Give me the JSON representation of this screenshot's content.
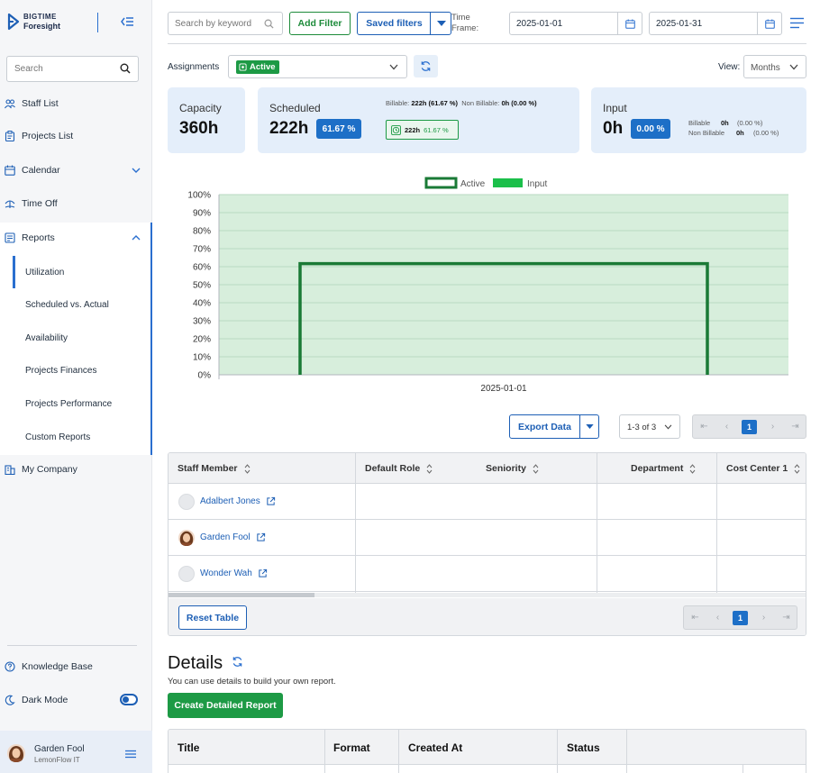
{
  "brand": {
    "line1": "BIGTIME",
    "line2": "Foresight"
  },
  "sidebar": {
    "search_placeholder": "Search",
    "items": [
      {
        "label": "Staff List",
        "icon": "users-icon"
      },
      {
        "label": "Projects List",
        "icon": "clipboard-icon"
      },
      {
        "label": "Calendar",
        "icon": "calendar-icon"
      },
      {
        "label": "Time Off",
        "icon": "time-off-icon"
      },
      {
        "label": "Reports",
        "icon": "report-icon"
      },
      {
        "label": "My Company",
        "icon": "building-icon"
      }
    ],
    "report_sub": [
      "Utilization",
      "Scheduled vs. Actual",
      "Availability",
      "Projects Finances",
      "Projects Performance",
      "Custom Reports"
    ],
    "active_sub": "Utilization",
    "knowledge_base": "Knowledge Base",
    "dark_mode": "Dark Mode",
    "dark_mode_on": true,
    "user": {
      "name": "Garden Fool",
      "org": "LemonFlow IT"
    }
  },
  "toolbar": {
    "keyword_placeholder": "Search by keyword",
    "add_filter": "Add Filter",
    "saved_filters": "Saved filters",
    "time_frame_label_1": "Time",
    "time_frame_label_2": "Frame:",
    "date_from": "2025-01-01",
    "date_to": "2025-01-31"
  },
  "filters": {
    "assignments_label": "Assignments",
    "assignment_chip": "Active",
    "view_label": "View:",
    "view_value": "Months"
  },
  "cards": {
    "capacity": {
      "title": "Capacity",
      "value": "360h"
    },
    "scheduled": {
      "title": "Scheduled",
      "value": "222h",
      "pct": "61.67 %",
      "billable_label": "Billable:",
      "billable_value": "222h (61.67 %)",
      "non_billable_label": "Non Billable:",
      "non_billable_value": "0h (0.00 %)",
      "chip_hours": "222h",
      "chip_pct": "61.67 %"
    },
    "input": {
      "title": "Input",
      "value": "0h",
      "pct": "0.00 %",
      "billable_label": "Billable",
      "billable_hours": "0h",
      "billable_pct": "(0.00 %)",
      "non_billable_label": "Non Billable",
      "non_billable_hours": "0h",
      "non_billable_pct": "(0.00 %)"
    }
  },
  "chart_data": {
    "type": "area",
    "x": [
      "2025-01-01"
    ],
    "yticks": [
      "100%",
      "90%",
      "80%",
      "70%",
      "60%",
      "50%",
      "40%",
      "30%",
      "20%",
      "10%",
      "0%"
    ],
    "ylim": [
      0,
      100
    ],
    "series": [
      {
        "name": "Active",
        "values": [
          61.67
        ],
        "color": "#1a7a36"
      },
      {
        "name": "Input",
        "values": [
          0
        ],
        "color": "#1bbf4a"
      }
    ],
    "capacity_fill": 100,
    "grid": true,
    "legend_position": "top-center"
  },
  "table_controls": {
    "export": "Export Data",
    "range": "1-3 of 3",
    "page": "1",
    "reset": "Reset Table"
  },
  "table": {
    "columns": [
      "Staff Member",
      "Default Role",
      "Seniority",
      "Department",
      "Cost Center 1"
    ],
    "rows": [
      {
        "name": "Adalbert Jones",
        "has_photo": false
      },
      {
        "name": "Garden Fool",
        "has_photo": true
      },
      {
        "name": "Wonder Wah",
        "has_photo": false
      }
    ]
  },
  "details": {
    "title": "Details",
    "description": "You can use details to build your own report.",
    "create_button": "Create Detailed Report",
    "columns": [
      "Title",
      "Format",
      "Created At",
      "Status"
    ]
  }
}
